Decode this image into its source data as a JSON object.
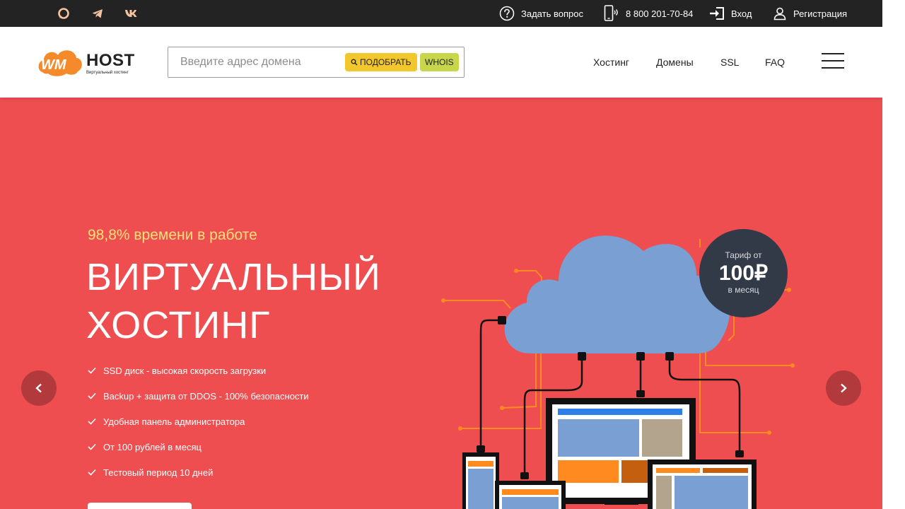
{
  "topbar": {
    "social": [
      {
        "name": "chat-icon"
      },
      {
        "name": "telegram-icon"
      },
      {
        "name": "vk-icon"
      }
    ],
    "ask_question": "Задать вопрос",
    "phone": "8 800 201-70-84",
    "login": "Вход",
    "register": "Регистрация"
  },
  "header": {
    "logo_main": "HOST",
    "logo_sub": "Виртуальный хостинг",
    "search_placeholder": "Введите адрес домена",
    "pick_button": "ПОДОБРАТЬ",
    "whois_button": "WHOIS",
    "nav": [
      "Хостинг",
      "Домены",
      "SSL",
      "FAQ"
    ]
  },
  "hero": {
    "tagline": "98,8% времени в работе",
    "title_line1": "ВИРТУАЛЬНЫЙ",
    "title_line2": "ХОСТИНГ",
    "features": [
      "SSD диск - высокая скорость загрузки",
      "Backup + защита от DDOS - 100% безопасности",
      "Удобная панель администратора",
      "От 100 рублей в месяц",
      "Тестовый период 10 дней"
    ],
    "badge": {
      "line1": "Тариф от",
      "price": "100₽",
      "line3": "в месяц"
    }
  },
  "colors": {
    "topbar_bg": "#232323",
    "hero_bg": "#ef4e50",
    "accent_yellow": "#f2c72e",
    "accent_green": "#c7d64a",
    "tagline": "#fde07a",
    "logo_orange": "#f58a2b",
    "cloud": "#7a9fd3",
    "badge_bg": "#333a47"
  }
}
